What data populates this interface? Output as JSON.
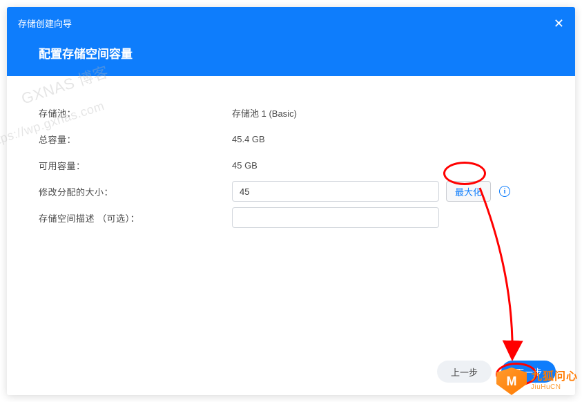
{
  "header": {
    "wizard_title": "存储创建向导",
    "main_title": "配置存储空间容量",
    "close": "✕"
  },
  "rows": {
    "pool_label": "存储池：",
    "pool_value": "存储池 1 (Basic)",
    "total_label": "总容量：",
    "total_value": "45.4 GB",
    "avail_label": "可用容量：",
    "avail_value": "45 GB",
    "size_label": "修改分配的大小：",
    "size_value": "45",
    "max_btn": "最大化",
    "desc_label": "存储空间描述 （可选）：",
    "desc_value": ""
  },
  "footer": {
    "back": "上一步",
    "next": "下一步"
  },
  "watermark": {
    "line1": "GXNAS 博客",
    "line2": "https://wp.gxnas.com"
  },
  "logo": {
    "glyph": "M",
    "cn": "九狐问心",
    "en": "JiuHuCN"
  }
}
